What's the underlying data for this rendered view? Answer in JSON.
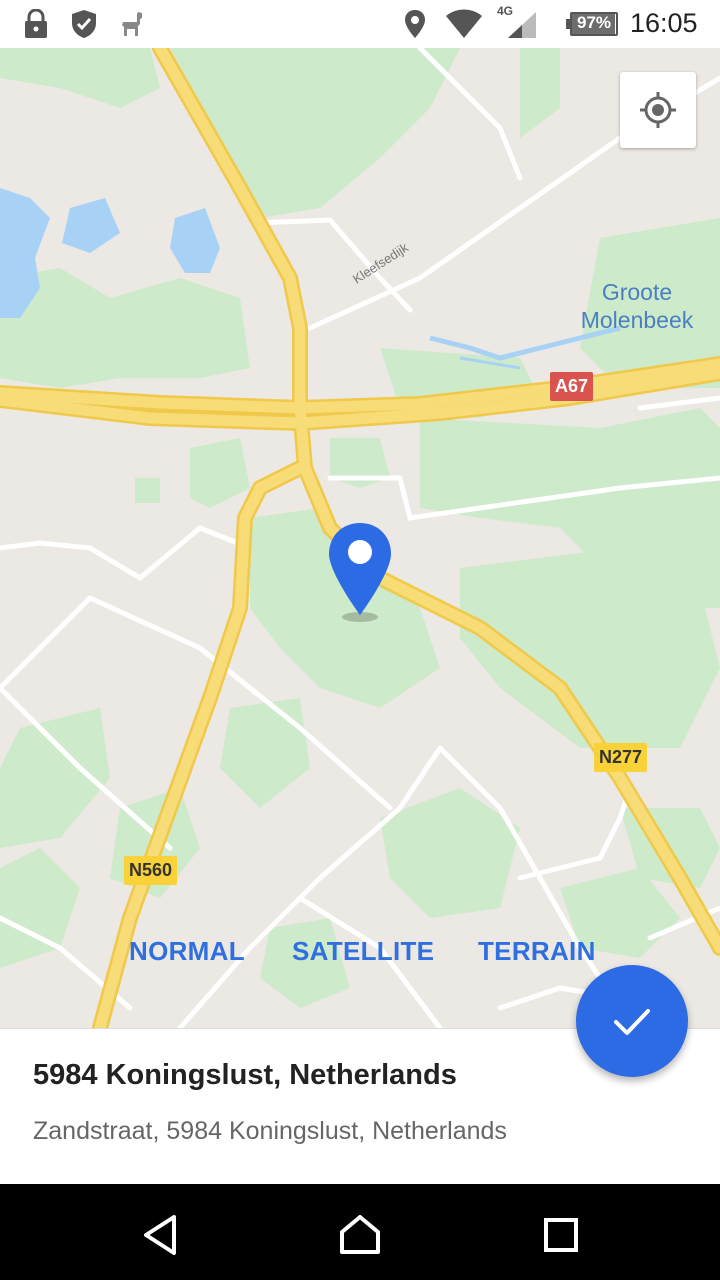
{
  "status_bar": {
    "icons": [
      "lock-icon",
      "shield-icon",
      "llama-icon",
      "location-icon",
      "wifi-icon",
      "cell-signal-icon",
      "battery-icon"
    ],
    "network": "4G",
    "battery_level": 0.97,
    "battery_text": "97%",
    "time": "16:05"
  },
  "map": {
    "road_labels": {
      "a67": "A67",
      "n277": "N277",
      "n560": "N560"
    },
    "street_name": "Kleefsedijk",
    "water_name": "Groote Molenbeek",
    "colors": {
      "land": "#ece8e3",
      "forest": "#cdeacb",
      "water": "#a8d2f5",
      "major_road": "#f8d86a",
      "minor_road": "#ffffff",
      "pin": "#2d6be4"
    }
  },
  "map_types": {
    "normal": "NORMAL",
    "satellite": "SATELLITE",
    "terrain": "TERRAIN"
  },
  "place": {
    "title": "5984 Koningslust, Netherlands",
    "address": "Zandstraat, 5984 Koningslust, Netherlands"
  },
  "colors": {
    "accent": "#2d6be4"
  },
  "nav_bar": {
    "icons": [
      "back-icon",
      "home-icon",
      "recents-icon"
    ]
  }
}
